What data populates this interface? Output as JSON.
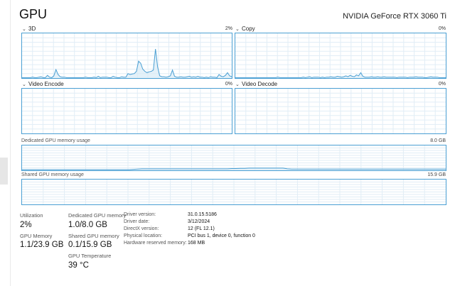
{
  "header": {
    "title": "GPU",
    "device": "NVIDIA GeForce RTX 3060 Ti"
  },
  "graphs": [
    {
      "label": "3D",
      "percent": "2%",
      "color": "#4a9fd3",
      "values": [
        1,
        1,
        1,
        1,
        1,
        2,
        1,
        1,
        2,
        3,
        1,
        1,
        6,
        2,
        1,
        5,
        19,
        8,
        3,
        2,
        2,
        1,
        1,
        1,
        1,
        1,
        1,
        1,
        1,
        1,
        2,
        1,
        1,
        1,
        2,
        1,
        4,
        1,
        2,
        2,
        2,
        1,
        1,
        4,
        2,
        1,
        1,
        3,
        2,
        2,
        10,
        8,
        9,
        10,
        15,
        38,
        33,
        20,
        15,
        12,
        14,
        15,
        18,
        65,
        25,
        5,
        3,
        3,
        2,
        3,
        5,
        18,
        4,
        2,
        2,
        3,
        2,
        2,
        3,
        4,
        2,
        3,
        2,
        4,
        2,
        2,
        1,
        2,
        1,
        3,
        2,
        2,
        1,
        8,
        4,
        3,
        6,
        12,
        5,
        3
      ]
    },
    {
      "label": "Copy",
      "percent": "0%",
      "color": "#4a9fd3",
      "values": [
        1,
        1,
        1,
        1,
        1,
        1,
        1,
        1,
        1,
        1,
        1,
        1,
        1,
        1,
        1,
        1,
        1,
        1,
        1,
        1,
        2,
        1,
        1,
        1,
        1,
        1,
        1,
        1,
        1,
        1,
        1,
        1,
        2,
        1,
        2,
        3,
        1,
        2,
        2,
        2,
        1,
        2,
        1,
        2,
        2,
        3,
        2,
        2,
        4,
        3,
        2,
        3,
        5,
        3,
        6,
        4,
        3,
        7,
        5,
        12,
        4,
        2,
        2,
        2,
        3,
        2,
        2,
        3,
        2,
        2,
        3,
        2,
        2,
        2,
        2,
        2,
        1,
        2,
        2,
        2,
        2,
        1,
        2,
        2,
        2,
        3,
        2,
        2,
        2,
        1,
        1,
        2,
        3,
        2,
        2,
        2,
        1,
        1,
        1,
        1
      ]
    },
    {
      "label": "Video Encode",
      "percent": "0%",
      "color": "#4a9fd3",
      "values": []
    },
    {
      "label": "Video Decode",
      "percent": "0%",
      "color": "#4a9fd3",
      "values": []
    }
  ],
  "dedicated_memory": {
    "label": "Dedicated GPU memory usage",
    "max": "8.0 GB",
    "values": [
      3,
      3,
      3,
      3,
      3,
      3,
      3,
      3,
      3,
      3,
      3,
      3,
      3,
      3,
      3,
      3,
      3,
      3,
      3,
      3,
      3,
      3,
      3,
      3,
      3,
      3,
      4,
      5,
      6,
      6,
      6,
      6,
      6,
      6,
      6,
      6,
      6,
      6,
      6,
      6,
      6,
      6,
      6,
      6,
      6,
      6,
      6,
      6,
      6,
      7,
      7,
      8,
      8,
      9,
      9,
      9,
      9,
      9,
      9,
      9,
      9,
      9,
      6,
      5,
      5,
      5,
      5,
      5,
      5,
      5,
      5,
      5,
      5,
      5,
      5,
      5,
      5,
      5,
      5,
      5,
      5,
      5,
      5,
      5,
      5,
      5,
      5,
      5,
      5,
      5,
      5,
      5,
      5,
      5,
      5,
      5,
      5,
      5,
      5,
      5
    ]
  },
  "shared_memory": {
    "label": "Shared GPU memory usage",
    "max": "15.9 GB",
    "values": []
  },
  "stats": {
    "utilization": {
      "label": "Utilization",
      "value": "2%"
    },
    "dedicated_mem": {
      "label": "Dedicated GPU memory",
      "value": "1.0/8.0 GB"
    },
    "gpu_memory": {
      "label": "GPU Memory",
      "value": "1.1/23.9 GB"
    },
    "shared_mem": {
      "label": "Shared GPU memory",
      "value": "0.1/15.9 GB"
    },
    "temperature": {
      "label": "GPU Temperature",
      "value": "39 °C"
    }
  },
  "info": [
    {
      "key": "Driver version:",
      "value": "31.0.15.5186"
    },
    {
      "key": "Driver date:",
      "value": "3/12/2024"
    },
    {
      "key": "DirectX version:",
      "value": "12 (FL 12.1)"
    },
    {
      "key": "Physical location:",
      "value": "PCI bus 1, device 0, function 0"
    },
    {
      "key": "Hardware reserved memory:",
      "value": "168 MB"
    }
  ]
}
